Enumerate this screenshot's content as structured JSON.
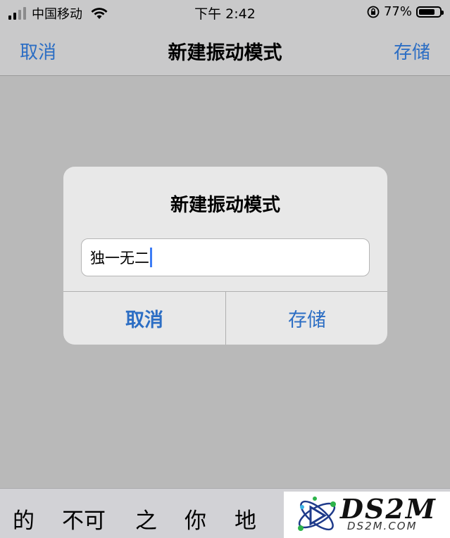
{
  "status_bar": {
    "carrier": "中国移动",
    "time": "下午 2:42",
    "battery_percent": "77%",
    "battery_level": 0.77,
    "signal_bars_active": 2,
    "signal_bars_total": 4
  },
  "nav": {
    "left_label": "取消",
    "title": "新建振动模式",
    "right_label": "存储"
  },
  "dialog": {
    "title": "新建振动模式",
    "input_value": "独一无二",
    "cancel_label": "取消",
    "save_label": "存储"
  },
  "candidates": [
    "的",
    "不可",
    "之",
    "你",
    "地"
  ],
  "watermark": {
    "text": "DS2M",
    "sub": "DS2M.COM"
  },
  "colors": {
    "accent": "#2c6ec4",
    "caret": "#3d7cf5",
    "dim_overlay": "#b9b9b9"
  }
}
